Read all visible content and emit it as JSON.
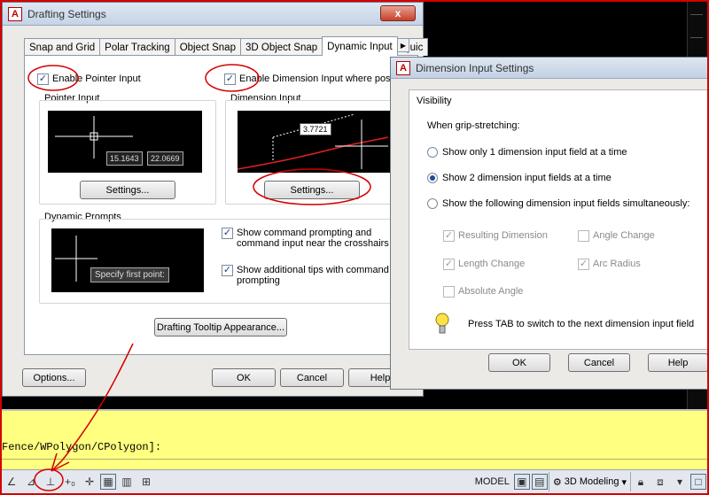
{
  "drafting": {
    "title": "Drafting Settings",
    "close_glyph": "x",
    "tabs": [
      "Snap and Grid",
      "Polar Tracking",
      "Object Snap",
      "3D Object Snap",
      "Dynamic Input",
      "Quic"
    ],
    "enable_pointer": "Enable Pointer Input",
    "enable_dimension": "Enable Dimension Input where possib",
    "pointer_group": "Pointer Input",
    "dimension_group": "Dimension Input",
    "coord_x": "15.1643",
    "coord_y": "22.0669",
    "dim_value": "3.7721",
    "settings_label": "Settings...",
    "prompts_group": "Dynamic Prompts",
    "prompt_tip": "Specify first point:",
    "show_cmd_prompting": "Show command prompting and command input near the crosshairs",
    "show_tips": "Show additional tips with command prompting",
    "tooltip_appearance": "Drafting Tooltip Appearance...",
    "options": "Options...",
    "ok": "OK",
    "cancel": "Cancel",
    "help": "Help"
  },
  "dim_settings": {
    "title": "Dimension Input Settings",
    "visibility": "Visibility",
    "when": "When grip-stretching:",
    "radio1": "Show only 1 dimension input field at a time",
    "radio2": "Show 2 dimension input fields at a time",
    "radio3": "Show the following dimension input fields simultaneously:",
    "resulting": "Resulting Dimension",
    "angle_change": "Angle Change",
    "length_change": "Length Change",
    "arc_radius": "Arc Radius",
    "absolute_angle": "Absolute Angle",
    "tab_tip": "Press TAB to switch to the next dimension input field",
    "ok": "OK",
    "cancel": "Cancel",
    "help": "Help"
  },
  "command_line": "Fence/WPolygon/CPolygon]:",
  "status": {
    "model": "MODEL",
    "workspace": "3D Modeling"
  },
  "colors": {
    "annotation_red": "#d40000",
    "command_bg": "#ffff80"
  }
}
